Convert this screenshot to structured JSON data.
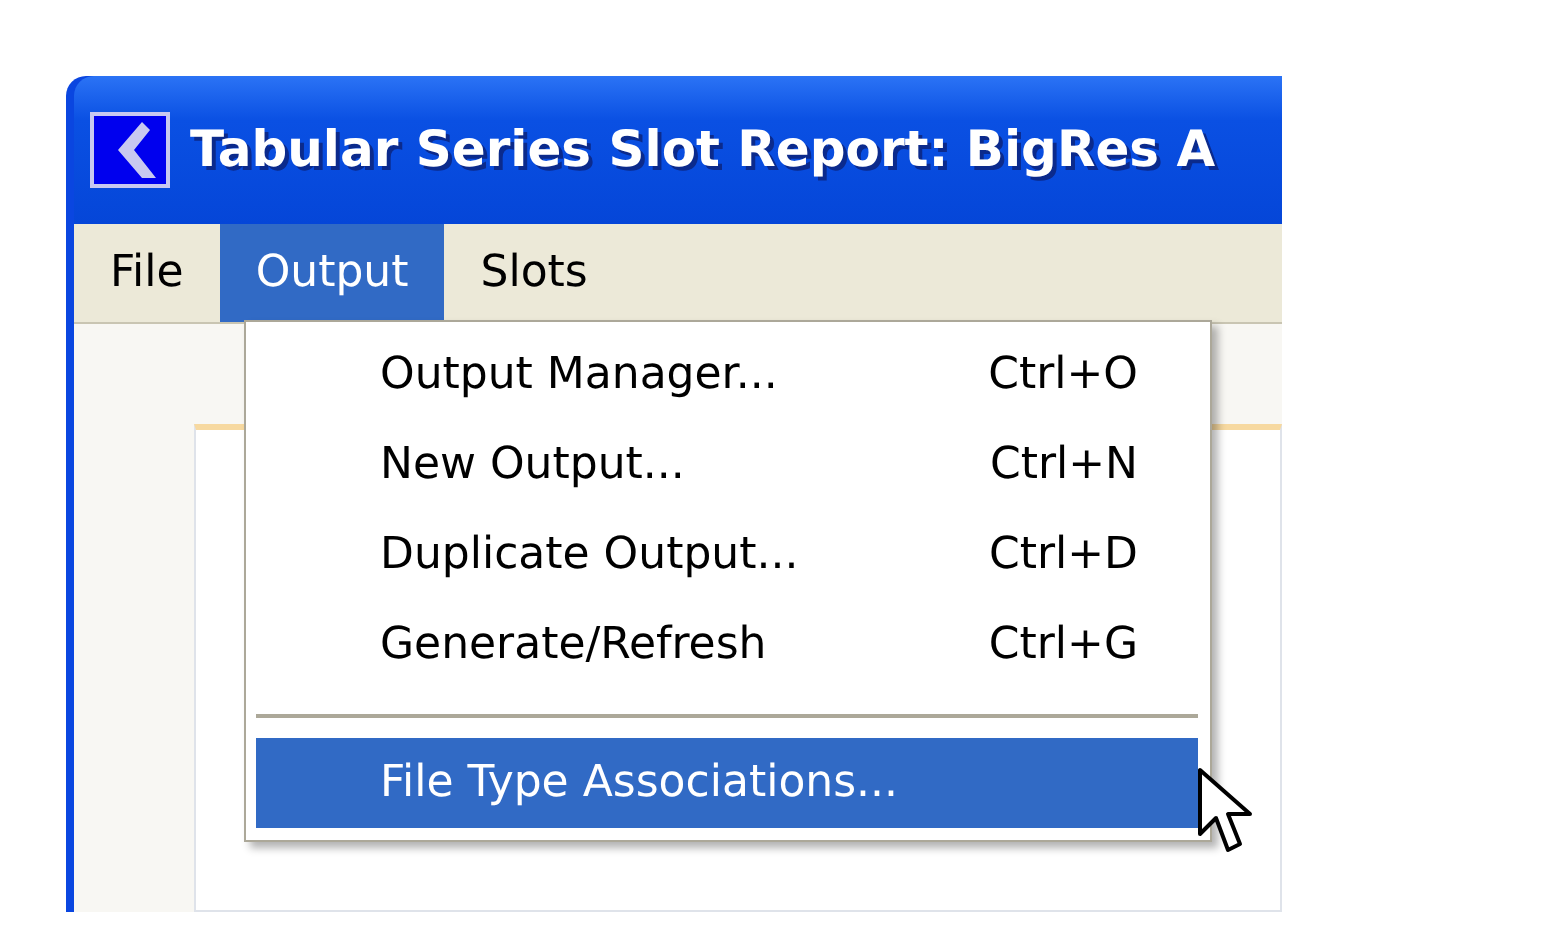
{
  "window": {
    "title": "Tabular Series Slot Report: BigRes A"
  },
  "menu_bar": [
    {
      "label": "File",
      "selected": false
    },
    {
      "label": "Output",
      "selected": true
    },
    {
      "label": "Slots",
      "selected": false
    }
  ],
  "menu": [
    {
      "kind": "item",
      "label": "Output Manager...",
      "shortcut": "Ctrl+O",
      "selected": false
    },
    {
      "kind": "item",
      "label": "New Output...",
      "shortcut": "Ctrl+N",
      "selected": false
    },
    {
      "kind": "item",
      "label": "Duplicate Output...",
      "shortcut": "Ctrl+D",
      "selected": false
    },
    {
      "kind": "item",
      "label": "Generate/Refresh",
      "shortcut": "Ctrl+G",
      "selected": false
    },
    {
      "kind": "separator"
    },
    {
      "kind": "item",
      "label": "File Type Associations...",
      "selected": true
    }
  ]
}
